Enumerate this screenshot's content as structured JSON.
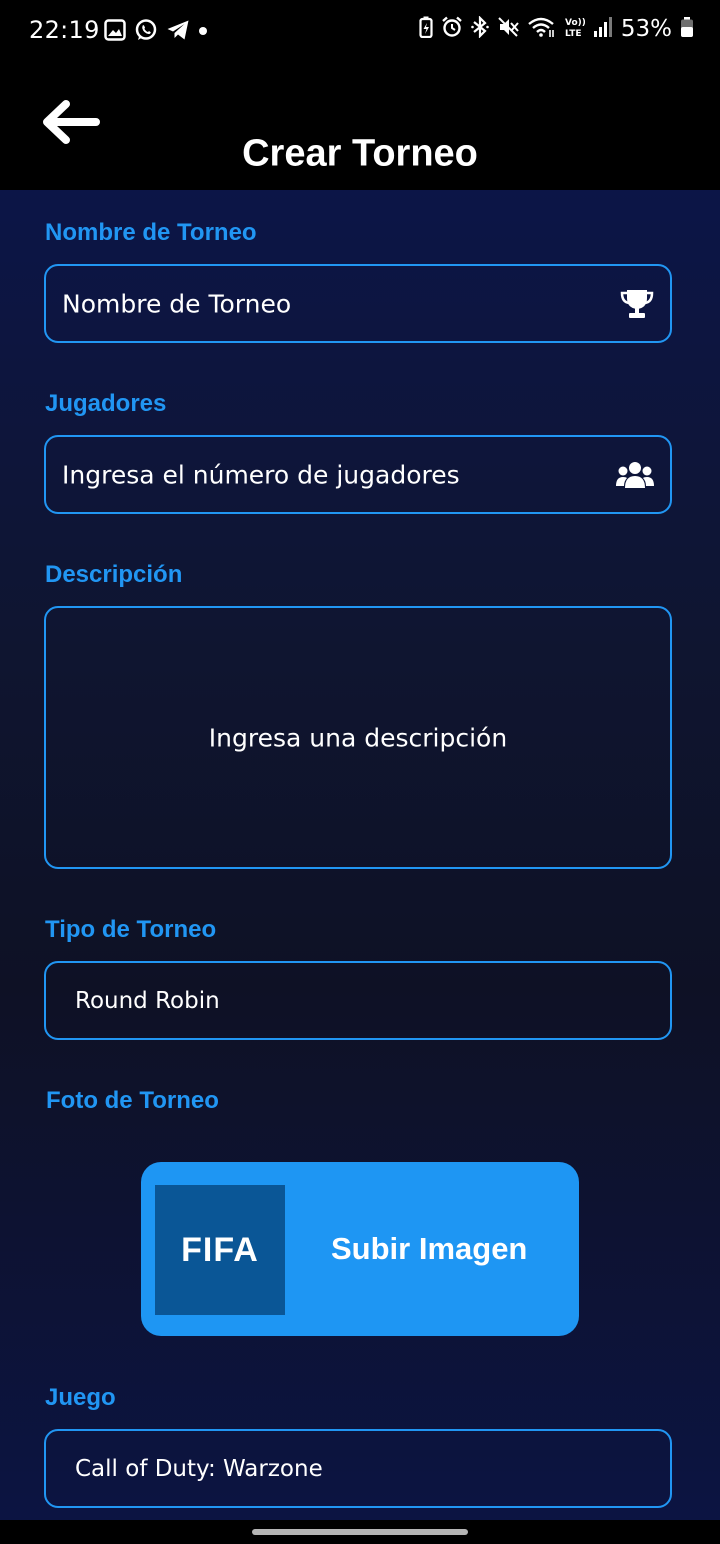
{
  "colors": {
    "accent": "#2196f3",
    "button": "#1e96f3",
    "header_bg": "#000000",
    "content_bg": "#0c1547"
  },
  "status_bar": {
    "time": "22:19",
    "battery_percent": "53%",
    "left_icons": [
      "gallery-icon",
      "whatsapp-icon",
      "telegram-icon",
      "dot-icon"
    ],
    "right_icons": [
      "battery-saver-icon",
      "alarm-icon",
      "bluetooth-icon",
      "mute-icon",
      "wifi-icon",
      "volte-icon",
      "signal-icon",
      "battery-icon"
    ]
  },
  "header": {
    "title": "Crear Torneo",
    "back_icon": "arrow-left-icon"
  },
  "form": {
    "name": {
      "label": "Nombre de Torneo",
      "placeholder": "Nombre de Torneo",
      "icon": "trophy-icon"
    },
    "players": {
      "label": "Jugadores",
      "placeholder": "Ingresa el número de jugadores",
      "icon": "users-icon"
    },
    "description": {
      "label": "Descripción",
      "placeholder": "Ingresa una descripción"
    },
    "type": {
      "label": "Tipo de Torneo",
      "value": "Round Robin"
    },
    "photo": {
      "label": "Foto de Torneo",
      "thumbnail_text": "FIFA",
      "button_label": "Subir Imagen"
    },
    "game": {
      "label": "Juego",
      "value": "Call of Duty: Warzone"
    }
  }
}
